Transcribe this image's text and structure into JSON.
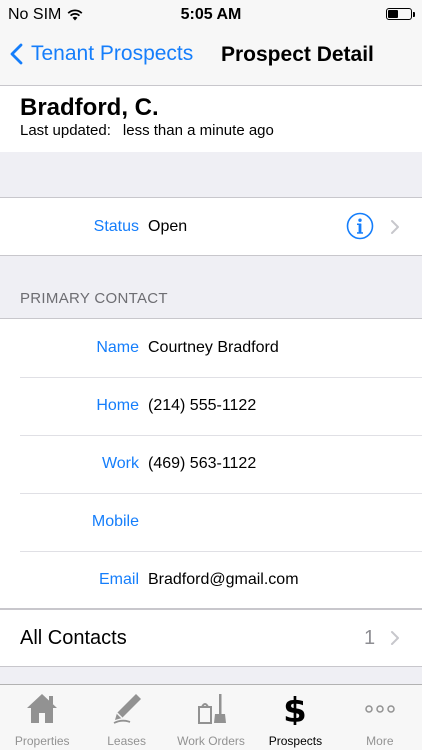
{
  "status_bar": {
    "carrier": "No SIM",
    "time": "5:05 AM"
  },
  "nav": {
    "back_label": "Tenant Prospects",
    "title": "Prospect Detail"
  },
  "prospect": {
    "name": "Bradford, C.",
    "last_updated_label": "Last updated:",
    "last_updated_value": "less than a minute ago"
  },
  "status_row": {
    "label": "Status",
    "value": "Open"
  },
  "primary_contact": {
    "section_title": "PRIMARY CONTACT",
    "rows": [
      {
        "label": "Name",
        "value": "Courtney Bradford"
      },
      {
        "label": "Home",
        "value": "(214) 555-1122"
      },
      {
        "label": "Work",
        "value": "(469) 563-1122"
      },
      {
        "label": "Mobile",
        "value": ""
      },
      {
        "label": "Email",
        "value": "Bradford@gmail.com"
      }
    ]
  },
  "all_contacts": {
    "label": "All Contacts",
    "count": "1"
  },
  "tab_bar": {
    "active": "prospects",
    "tabs": [
      {
        "id": "properties",
        "label": "Properties",
        "icon": "house-icon"
      },
      {
        "id": "leases",
        "label": "Leases",
        "icon": "pen-icon"
      },
      {
        "id": "work_orders",
        "label": "Work Orders",
        "icon": "tools-icon"
      },
      {
        "id": "prospects",
        "label": "Prospects",
        "icon": "dollar-icon"
      },
      {
        "id": "more",
        "label": "More",
        "icon": "more-dots-icon"
      }
    ]
  },
  "colors": {
    "accent": "#157efb",
    "background": "#efeff4",
    "section_text": "#6d6d72",
    "inactive_tab": "#929292"
  }
}
